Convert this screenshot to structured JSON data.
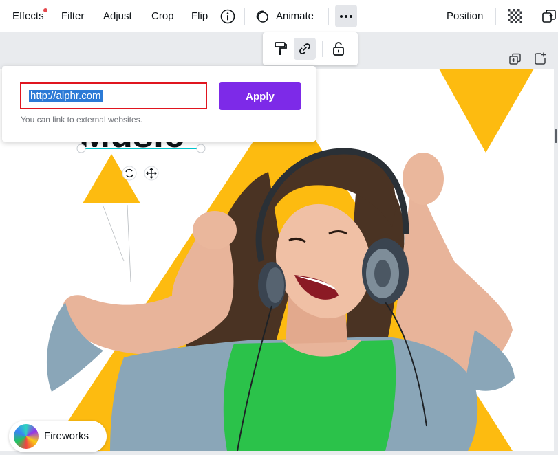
{
  "toolbar": {
    "effects": "Effects",
    "filter": "Filter",
    "adjust": "Adjust",
    "crop": "Crop",
    "flip": "Flip",
    "animate": "Animate",
    "position": "Position"
  },
  "mini_toolbar": {
    "icons": [
      "paint-roller-icon",
      "link-icon",
      "lock-icon"
    ],
    "active": "link-icon"
  },
  "link_popup": {
    "url_value": "http://alphr.com",
    "apply_label": "Apply",
    "hint": "You can link to external websites."
  },
  "canvas": {
    "element_text": "Music"
  },
  "chip": {
    "label": "Fireworks"
  },
  "colors": {
    "accent": "#7d2ae8",
    "highlight_border": "#e0151f",
    "triangle_yellow": "#fdbb10",
    "shirt_green": "#2bc24a",
    "notification_dot": "#e5484d"
  }
}
